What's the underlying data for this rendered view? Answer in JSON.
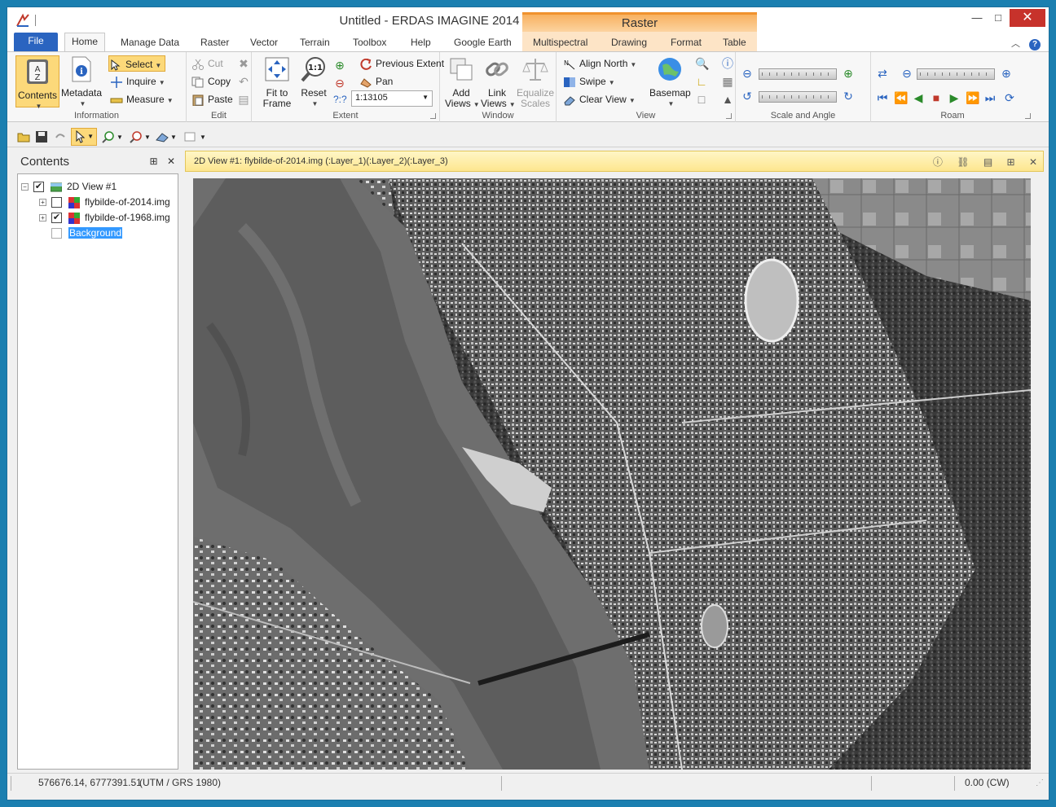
{
  "window": {
    "title": "Untitled - ERDAS IMAGINE 2014",
    "context_tab_header": "Raster",
    "minimize": "—",
    "maximize": "□",
    "close": "✕"
  },
  "tabs": {
    "file": "File",
    "items": [
      "Home",
      "Manage Data",
      "Raster",
      "Vector",
      "Terrain",
      "Toolbox",
      "Help",
      "Google Earth"
    ],
    "context_items": [
      "Multispectral",
      "Drawing",
      "Format",
      "Table"
    ],
    "active": "Home"
  },
  "ribbon": {
    "information": {
      "label": "Information",
      "contents": "Contents",
      "metadata": "Metadata",
      "select": "Select",
      "inquire": "Inquire",
      "measure": "Measure"
    },
    "edit": {
      "label": "Edit",
      "cut": "Cut",
      "copy": "Copy",
      "paste": "Paste"
    },
    "extent": {
      "label": "Extent",
      "fit_to_frame_1": "Fit to",
      "fit_to_frame_2": "Frame",
      "reset": "Reset",
      "previous_extent": "Previous Extent",
      "pan": "Pan",
      "scale_value": "1:13105",
      "question": "?:?"
    },
    "window": {
      "label": "Window",
      "add_views_1": "Add",
      "add_views_2": "Views",
      "link_views_1": "Link",
      "link_views_2": "Views",
      "equalize_scales_1": "Equalize",
      "equalize_scales_2": "Scales"
    },
    "view": {
      "label": "View",
      "align_north": "Align North",
      "swipe": "Swipe",
      "clear_view": "Clear View",
      "basemap": "Basemap"
    },
    "scale_and_angle": {
      "label": "Scale and Angle"
    },
    "roam": {
      "label": "Roam"
    }
  },
  "contents_pane": {
    "title": "Contents",
    "pin": "⊞",
    "close": "✕",
    "tree": [
      {
        "label": "2D View #1",
        "checked": true
      },
      {
        "label": "flybilde-of-2014.img",
        "checked": false
      },
      {
        "label": "flybilde-of-1968.img",
        "checked": true
      },
      {
        "label": "Background",
        "checked": false
      }
    ]
  },
  "view_pane": {
    "title": "2D View #1: flybilde-of-2014.img (:Layer_1)(:Layer_2)(:Layer_3)",
    "pin": "⊞",
    "close": "✕"
  },
  "status": {
    "coords": "576676.14, 6777391.51",
    "projection": "(UTM / GRS 1980)",
    "rotation": "0.00 (CW)"
  },
  "colors": {
    "accent": "#2a64c0",
    "context": "#f8b160",
    "view_header": "#fde68f",
    "window_border": "#1b7fb0"
  }
}
